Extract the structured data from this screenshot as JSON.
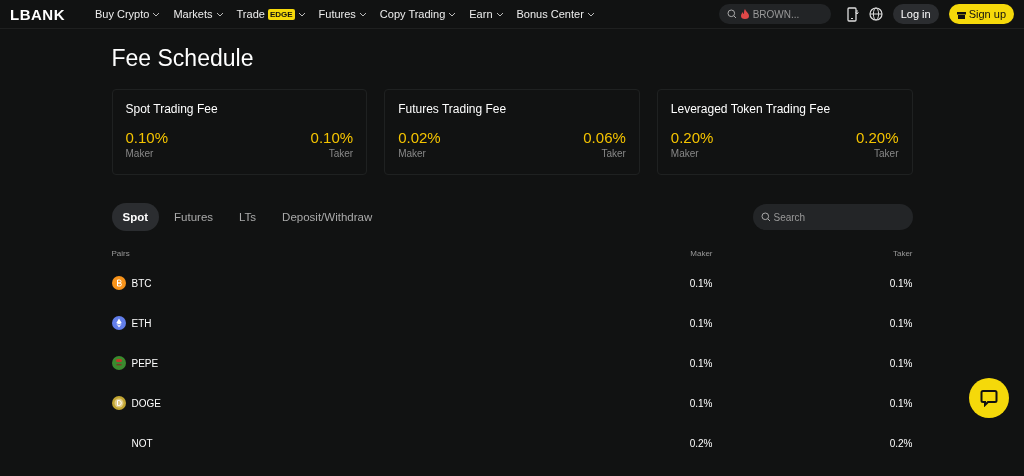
{
  "header": {
    "logo": "LBANK",
    "nav": [
      {
        "label": "Buy Crypto"
      },
      {
        "label": "Markets"
      },
      {
        "label": "Trade",
        "badge": "EDGE"
      },
      {
        "label": "Futures"
      },
      {
        "label": "Copy Trading"
      },
      {
        "label": "Earn"
      },
      {
        "label": "Bonus Center"
      }
    ],
    "search": {
      "placeholder": "BROWN..."
    },
    "login": "Log in",
    "signup": "Sign up"
  },
  "title": "Fee Schedule",
  "cards": [
    {
      "title": "Spot Trading Fee",
      "maker": "0.10%",
      "maker_label": "Maker",
      "taker": "0.10%",
      "taker_label": "Taker"
    },
    {
      "title": "Futures Trading Fee",
      "maker": "0.02%",
      "maker_label": "Maker",
      "taker": "0.06%",
      "taker_label": "Taker"
    },
    {
      "title": "Leveraged Token Trading Fee",
      "maker": "0.20%",
      "maker_label": "Maker",
      "taker": "0.20%",
      "taker_label": "Taker"
    }
  ],
  "tabs": [
    {
      "label": "Spot",
      "selected": true
    },
    {
      "label": "Futures",
      "selected": false
    },
    {
      "label": "LTs",
      "selected": false
    },
    {
      "label": "Deposit/Withdraw",
      "selected": false
    }
  ],
  "search": {
    "placeholder": "Search"
  },
  "table": {
    "columns": [
      "Pairs",
      "Maker",
      "Taker"
    ],
    "rows": [
      {
        "kind": "btc",
        "pair": "BTC",
        "maker": "0.1%",
        "taker": "0.1%"
      },
      {
        "kind": "eth",
        "pair": "ETH",
        "maker": "0.1%",
        "taker": "0.1%"
      },
      {
        "kind": "pepe",
        "pair": "PEPE",
        "maker": "0.1%",
        "taker": "0.1%"
      },
      {
        "kind": "doge",
        "pair": "DOGE",
        "maker": "0.1%",
        "taker": "0.1%"
      },
      {
        "kind": "none",
        "pair": "NOT",
        "maker": "0.2%",
        "taker": "0.2%"
      }
    ]
  }
}
